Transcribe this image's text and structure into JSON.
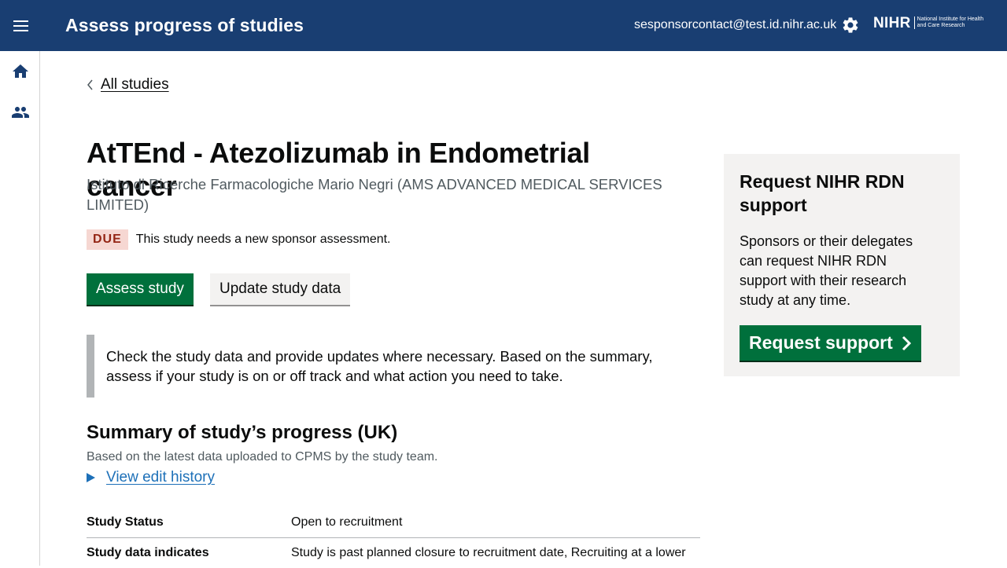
{
  "header": {
    "app_title": "Assess progress of studies",
    "user_email": "sesponsorcontact@test.id.nihr.ac.uk",
    "logo_word": "NIHR",
    "logo_subtitle": "National Institute for Health and Care Research",
    "bg_color": "#193e72"
  },
  "sidenav": {
    "items": [
      {
        "icon": "home-icon"
      },
      {
        "icon": "users-icon"
      }
    ]
  },
  "back_link": "All studies",
  "study": {
    "title": "AtTEnd - Atezolizumab in Endometrial cancer",
    "sponsor": "Istituto di Ricerche Farmacologiche Mario Negri (AMS ADVANCED MEDICAL SERVICES LIMITED)",
    "status_tag": "DUE",
    "status_message": "This study needs a new sponsor assessment."
  },
  "actions": {
    "assess_label": "Assess study",
    "update_label": "Update study data"
  },
  "inset_text": "Check the study data and provide updates where necessary. Based on the summary, assess if your study is on or off track and what action you need to take.",
  "summary": {
    "heading": "Summary of study’s progress (UK)",
    "subheading": "Based on the latest data uploaded to CPMS by the study team.",
    "edit_history_label": "View edit history",
    "rows": [
      {
        "key": "Study Status",
        "value": "Open to recruitment"
      },
      {
        "key": "Study data indicates",
        "value": "Study is past planned closure to recruitment date, Recruiting at a lower"
      }
    ]
  },
  "support_panel": {
    "heading": "Request NIHR RDN support",
    "body": "Sponsors or their delegates can request NIHR RDN support with their research study at any time.",
    "button_label": "Request support"
  },
  "colors": {
    "primary_green": "#00703c",
    "link_blue": "#1d70b8",
    "due_bg": "#f6d7d2",
    "due_text": "#942514"
  }
}
